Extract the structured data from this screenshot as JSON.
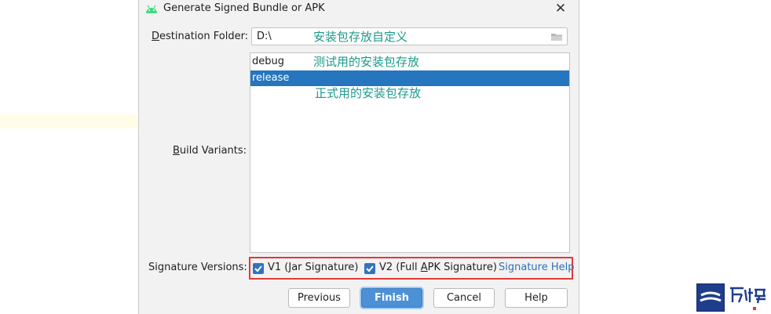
{
  "dialog": {
    "title": "Generate Signed Bundle or APK",
    "close_icon": "close-icon",
    "title_icon": "android-icon"
  },
  "destination": {
    "label_underlined": "D",
    "label_rest": "estination Folder:",
    "value": "D:\\",
    "note": "安装包存放自定义",
    "folder_icon": "folder-icon"
  },
  "build_variants": {
    "label_underlined": "B",
    "label_rest": "uild Variants:",
    "items": [
      {
        "label": "debug",
        "note": "测试用的安装包存放",
        "selected": false
      },
      {
        "label": "release",
        "note": "正式用的安装包存放",
        "selected": true
      }
    ]
  },
  "signature": {
    "label": "Signature Versions:",
    "v1": {
      "prefix": "V1 (",
      "underlined": "J",
      "rest": "ar Signature)",
      "checked": true
    },
    "v2": {
      "prefix": "V2 (Full ",
      "underlined": "A",
      "rest": "PK Signature)",
      "checked": true
    },
    "help_link": "Signature Help"
  },
  "buttons": {
    "previous": "Previous",
    "finish": "Finish",
    "cancel": "Cancel",
    "help": "Help"
  },
  "colors": {
    "accent": "#2675bf",
    "annotation": "#1b9a8a",
    "highlight_box": "#e53935"
  }
}
